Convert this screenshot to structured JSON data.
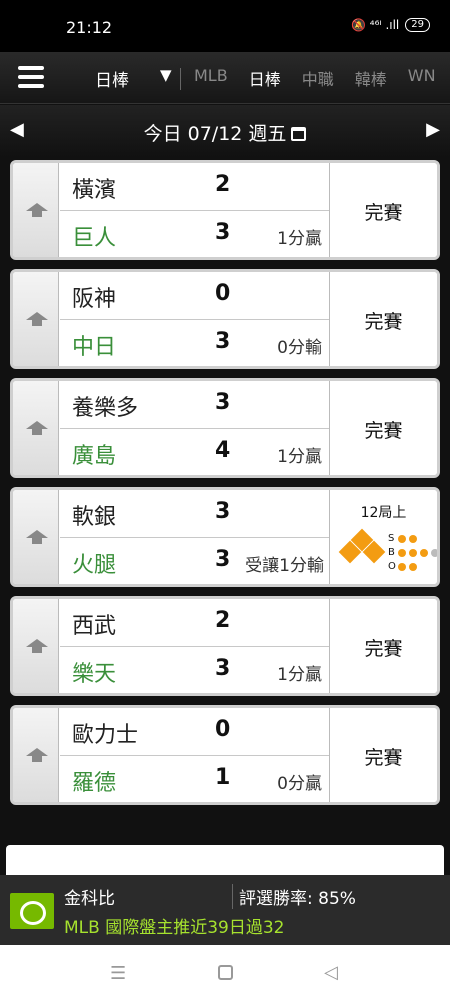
{
  "status_bar": {
    "time": "21:12",
    "icons": "🔕 ⁴⁶ᴵ .ıll",
    "battery": "29"
  },
  "nav": {
    "selected_league": "日棒",
    "tabs": [
      {
        "label": "MLB",
        "active": false
      },
      {
        "label": "日棒",
        "active": true
      },
      {
        "label": "中職",
        "active": false
      },
      {
        "label": "韓棒",
        "active": false
      },
      {
        "label": "WN",
        "active": false
      }
    ]
  },
  "date_bar": {
    "prev": "◀",
    "next": "▶",
    "date": "今日 07/12 週五"
  },
  "games": [
    {
      "away": {
        "name": "橫濱",
        "score": "2"
      },
      "home": {
        "name": "巨人",
        "score": "3"
      },
      "spread": "1分贏",
      "status": "完賽"
    },
    {
      "away": {
        "name": "阪神",
        "score": "0"
      },
      "home": {
        "name": "中日",
        "score": "3"
      },
      "spread": "0分輸",
      "status": "完賽"
    },
    {
      "away": {
        "name": "養樂多",
        "score": "3"
      },
      "home": {
        "name": "廣島",
        "score": "4"
      },
      "spread": "1分贏",
      "status": "完賽"
    },
    {
      "away": {
        "name": "軟銀",
        "score": "3"
      },
      "home": {
        "name": "火腿",
        "score": "3"
      },
      "spread": "受讓1分輸",
      "status": "12局上",
      "live": {
        "bases": {
          "first": true,
          "second": true,
          "third": true
        },
        "balls_strikes_outs": {
          "S": 2,
          "B": 3,
          "O": 2
        },
        "labels": {
          "s": "S",
          "b": "B",
          "o": "O"
        }
      }
    },
    {
      "away": {
        "name": "西武",
        "score": "2"
      },
      "home": {
        "name": "樂天",
        "score": "3"
      },
      "spread": "1分贏",
      "status": "完賽"
    },
    {
      "away": {
        "name": "歐力士",
        "score": "0"
      },
      "home": {
        "name": "羅德",
        "score": "1"
      },
      "spread": "0分贏",
      "status": "完賽"
    }
  ],
  "ad": {
    "title": "金科比",
    "rate": "評選勝率: 85%",
    "text": "MLB 國際盤主推近39日過32"
  },
  "colors": {
    "home_team": "#3a8f3a",
    "base_on": "#f39c12",
    "dot_on": "#f39c12",
    "dot_off": "#bbbbbb",
    "ad_text": "#a6e22e"
  }
}
